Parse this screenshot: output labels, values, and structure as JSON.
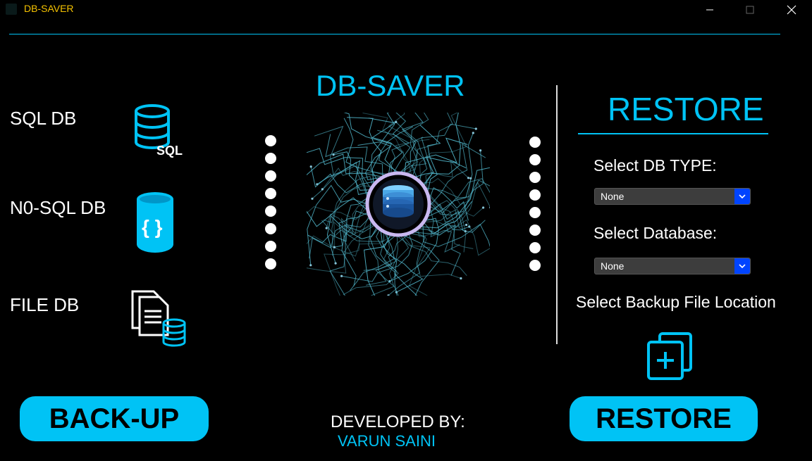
{
  "window": {
    "title": "DB-SAVER",
    "title_color": "#f5c200",
    "controls": {
      "minimize": "minimize-icon",
      "maximize": "maximize-icon",
      "close": "close-icon"
    }
  },
  "colors": {
    "accent": "#00c3f5",
    "background": "#000000",
    "text": "#ffffff",
    "select_arrow": "#0044ff"
  },
  "backup": {
    "items": [
      {
        "label": "SQL DB",
        "icon": "sql-database-icon",
        "icon_text": "SQL"
      },
      {
        "label": "N0-SQL DB",
        "icon": "nosql-database-icon",
        "icon_text": "{ }"
      },
      {
        "label": "FILE DB",
        "icon": "file-database-icon"
      }
    ],
    "button_label": "BACK-UP"
  },
  "center": {
    "title": "DB-SAVER",
    "emblem_icon": "database-emblem-icon"
  },
  "restore": {
    "heading": "RESTORE",
    "db_type_label": "Select DB TYPE:",
    "db_type_value": "None",
    "database_label": "Select Database:",
    "database_value": "None",
    "location_label": "Select Backup File Location",
    "location_icon": "add-file-icon",
    "button_label": "RESTORE"
  },
  "footer": {
    "developed_label": "DEVELOPED BY:",
    "developer_name": "VARUN SAINI"
  }
}
